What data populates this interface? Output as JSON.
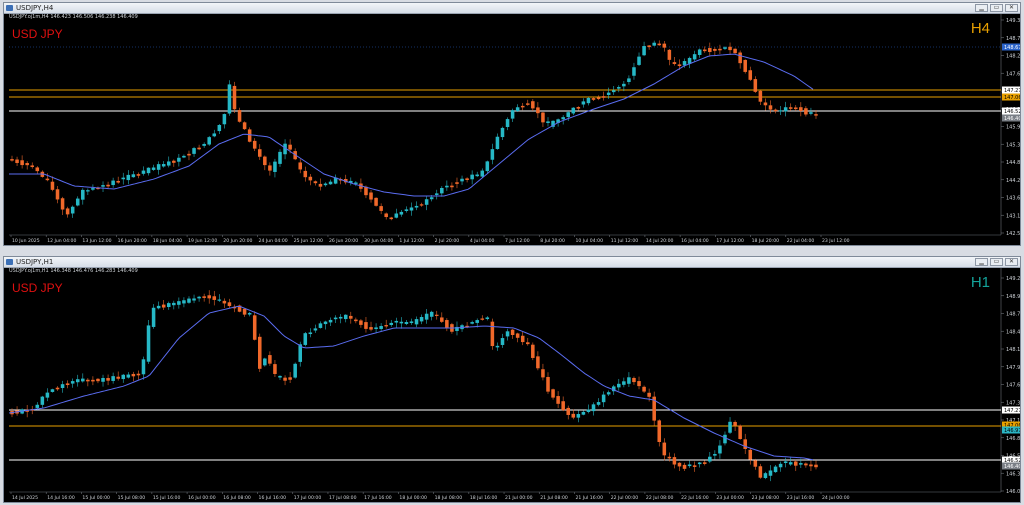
{
  "windows": [
    {
      "title": "USDJPY,H4",
      "info": "USDJPY.oj1m,H4  146.423 146.506 146.238 146.409",
      "symbol_label": "USD JPY",
      "timeframe": "H4",
      "tf_color": "#e8a000",
      "y_ticks": [
        "149.320",
        "148.793",
        "148.225",
        "147.649",
        "147.079",
        "146.522",
        "145.946",
        "145.376",
        "144.800",
        "144.250",
        "143.680",
        "143.110",
        "142.533"
      ],
      "x_ticks": [
        "10 Jun 2025",
        "12 Jun 04:00",
        "13 Jun 12:00",
        "16 Jun 20:00",
        "18 Jun 04:00",
        "19 Jun 12:00",
        "20 Jun 20:00",
        "24 Jun 04:00",
        "25 Jun 12:00",
        "26 Jun 20:00",
        "30 Jun 04:00",
        "1 Jul 12:00",
        "2 Jul 20:00",
        "4 Jul 04:00",
        "7 Jul 12:00",
        "8 Jul 20:00",
        "10 Jul 04:00",
        "11 Jul 12:00",
        "14 Jul 20:00",
        "16 Jul 04:00",
        "17 Jul 12:00",
        "18 Jul 20:00",
        "22 Jul 04:00",
        "23 Jul 12:00"
      ],
      "price_tags": [
        {
          "text": "148.672",
          "bg": "#2b63c8",
          "fg": "#ffffff"
        },
        {
          "text": "147.279",
          "bg": "#ffffff",
          "fg": "#000000"
        },
        {
          "text": "147.069",
          "bg": "#e8a000",
          "fg": "#000000"
        },
        {
          "text": "146.522",
          "bg": "#ffffff",
          "fg": "#000000"
        },
        {
          "text": "146.409",
          "bg": "#7a7f86",
          "fg": "#ffffff"
        }
      ]
    },
    {
      "title": "USDJPY,H1",
      "info": "USDJPY.oj1m,H1  146.348 146.476 146.283 146.409",
      "symbol_label": "USD JPY",
      "timeframe": "H1",
      "tf_color": "#14a39a",
      "y_ticks": [
        "149.240",
        "148.975",
        "148.705",
        "148.440",
        "148.175",
        "147.910",
        "147.645",
        "147.375",
        "147.110",
        "146.845",
        "146.580",
        "146.315",
        "146.050"
      ],
      "x_ticks": [
        "14 Jul 2025",
        "14 Jul 16:00",
        "15 Jul 00:00",
        "15 Jul 08:00",
        "15 Jul 16:00",
        "16 Jul 00:00",
        "16 Jul 08:00",
        "16 Jul 16:00",
        "17 Jul 00:00",
        "17 Jul 08:00",
        "17 Jul 16:00",
        "18 Jul 00:00",
        "18 Jul 08:00",
        "18 Jul 16:00",
        "21 Jul 00:00",
        "21 Jul 08:00",
        "21 Jul 16:00",
        "22 Jul 00:00",
        "22 Jul 08:00",
        "22 Jul 16:00",
        "23 Jul 00:00",
        "23 Jul 08:00",
        "23 Jul 16:00",
        "24 Jul 00:00"
      ],
      "price_tags": [
        {
          "text": "147.279",
          "bg": "#ffffff",
          "fg": "#000000"
        },
        {
          "text": "147.069",
          "bg": "#e8a000",
          "fg": "#000000"
        },
        {
          "text": "146.978",
          "bg": "#2bb5c4",
          "fg": "#000000"
        },
        {
          "text": "146.522",
          "bg": "#ffffff",
          "fg": "#000000"
        },
        {
          "text": "146.409",
          "bg": "#7a7f86",
          "fg": "#ffffff"
        }
      ]
    }
  ],
  "colors": {
    "bull": "#26b8c6",
    "bear": "#f0682a",
    "ma": "#5a6cf0",
    "bg": "#000000"
  }
}
